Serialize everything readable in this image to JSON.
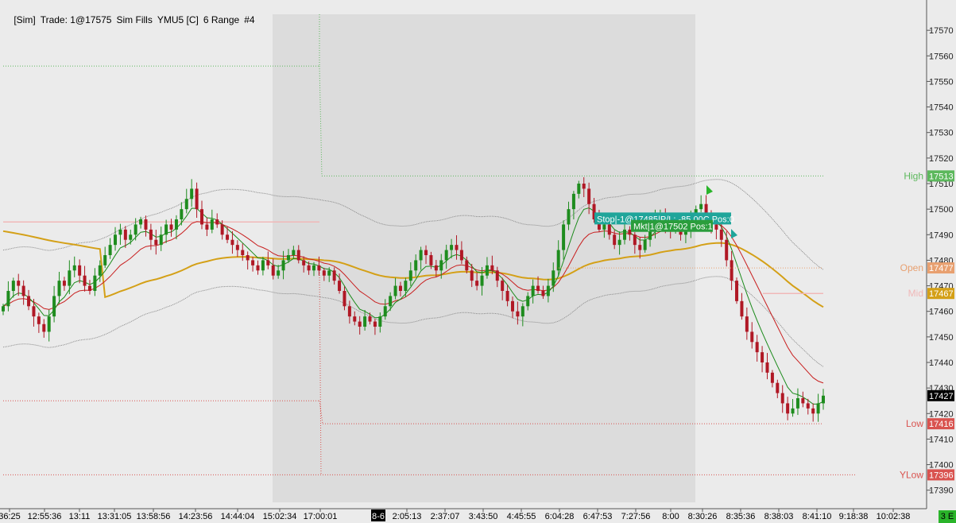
{
  "title": {
    "account": "[Sim]",
    "trade": "Trade: 1@17575",
    "fill_mode": "Sim Fills",
    "instrument": "YMU5 [C]",
    "bar_type": "6 Range",
    "panel_id": "#4"
  },
  "colors": {
    "background": "#ebebeb",
    "session_shade": "#dcdcdc",
    "up_candle": "#1e8c1e",
    "down_candle": "#b01825",
    "ema_fast": "#1a8a1a",
    "ema_slow": "#c81e1e",
    "vwap": "#d4a017",
    "high_color": "#5cb85c",
    "open_color": "#e8a070",
    "mid_color": "#f0b8b8",
    "low_color": "#d9534f",
    "ylow_color": "#d9534f",
    "stop_color": "#1fa59a",
    "mkt_color": "#2a9d3c",
    "last_price_bg": "#000000"
  },
  "y_axis": {
    "min": 17384,
    "max": 17580,
    "ticks": [
      "17570",
      "17560",
      "17550",
      "17540",
      "17530",
      "17520",
      "17510",
      "17500",
      "17490",
      "17480",
      "17470",
      "17460",
      "17450",
      "17440",
      "17430",
      "17420",
      "17410",
      "17400",
      "17390"
    ]
  },
  "x_axis": {
    "labels": [
      "36:25",
      "12:55:36",
      "13:11",
      "13:31:05",
      "13:58:56",
      "14:23:56",
      "14:44:04",
      "15:02:34",
      "17:00:01",
      "8-6",
      "2:05:13",
      "2:37:07",
      "3:43:50",
      "4:45:55",
      "6:04:28",
      "6:47:53",
      "7:27:56",
      "8:00",
      "8:30:26",
      "8:35:36",
      "8:38:03",
      "8:41:10",
      "9:18:38",
      "10:02:38"
    ],
    "date_marker": "8-6"
  },
  "levels": {
    "high": {
      "name": "High",
      "price": "17513",
      "value": 17513
    },
    "open": {
      "name": "Open",
      "price": "17477",
      "value": 17477
    },
    "mid": {
      "name": "Mid",
      "price": "17467",
      "value": 17467
    },
    "low": {
      "name": "Low",
      "price": "17416",
      "value": 17416
    },
    "ylow": {
      "name": "YLow",
      "price": "17396",
      "value": 17396
    },
    "prev_high": 17556,
    "prev_low": 17425,
    "prev_mid": 17495
  },
  "last_price": {
    "price": "17427",
    "value": 17427
  },
  "orders": {
    "stop": {
      "label": "Stop|-1@17485|P/L: -85.00C Pos:0",
      "value": 17485
    },
    "market": {
      "label": "Mkt|1@17502 Pos:1",
      "value": 17502
    }
  },
  "corner_badge": "3 E",
  "chart_data": {
    "type": "candlestick",
    "title": "",
    "ylim": [
      17384,
      17580
    ],
    "series": [
      {
        "name": "",
        "kind": "ohlc"
      }
    ],
    "closes": [
      17462,
      17468,
      17472,
      17470,
      17466,
      17462,
      17458,
      17455,
      17452,
      17458,
      17466,
      17472,
      17470,
      17476,
      17478,
      17474,
      17470,
      17468,
      17474,
      17478,
      17482,
      17486,
      17490,
      17492,
      17488,
      17490,
      17494,
      17496,
      17492,
      17488,
      17486,
      17490,
      17494,
      17492,
      17496,
      17500,
      17504,
      17508,
      17500,
      17494,
      17492,
      17496,
      17494,
      17490,
      17488,
      17486,
      17484,
      17482,
      17480,
      17478,
      17476,
      17480,
      17478,
      17474,
      17476,
      17480,
      17482,
      17484,
      17480,
      17478,
      17476,
      17478,
      17476,
      17474,
      17476,
      17472,
      17468,
      17462,
      17458,
      17456,
      17454,
      17458,
      17456,
      17454,
      17458,
      17462,
      17466,
      17470,
      17468,
      17472,
      17476,
      17480,
      17484,
      17482,
      17478,
      17476,
      17480,
      17484,
      17486,
      17484,
      17480,
      17476,
      17472,
      17470,
      17474,
      17478,
      17476,
      17472,
      17468,
      17464,
      17460,
      17458,
      17462,
      17466,
      17470,
      17468,
      17466,
      17470,
      17476,
      17484,
      17494,
      17500,
      17506,
      17510,
      17508,
      17502,
      17496,
      17492,
      17494,
      17490,
      17486,
      17488,
      17492,
      17490,
      17486,
      17484,
      17488,
      17492,
      17496,
      17498,
      17494,
      17492,
      17494,
      17490,
      17492,
      17496,
      17500,
      17502,
      17498,
      17494,
      17492,
      17488,
      17480,
      17472,
      17464,
      17458,
      17452,
      17448,
      17444,
      17440,
      17436,
      17432,
      17428,
      17424,
      17420,
      17422,
      17426,
      17424,
      17422,
      17420,
      17424,
      17427
    ],
    "ema_fast": [],
    "ema_slow": [],
    "vwap": []
  }
}
